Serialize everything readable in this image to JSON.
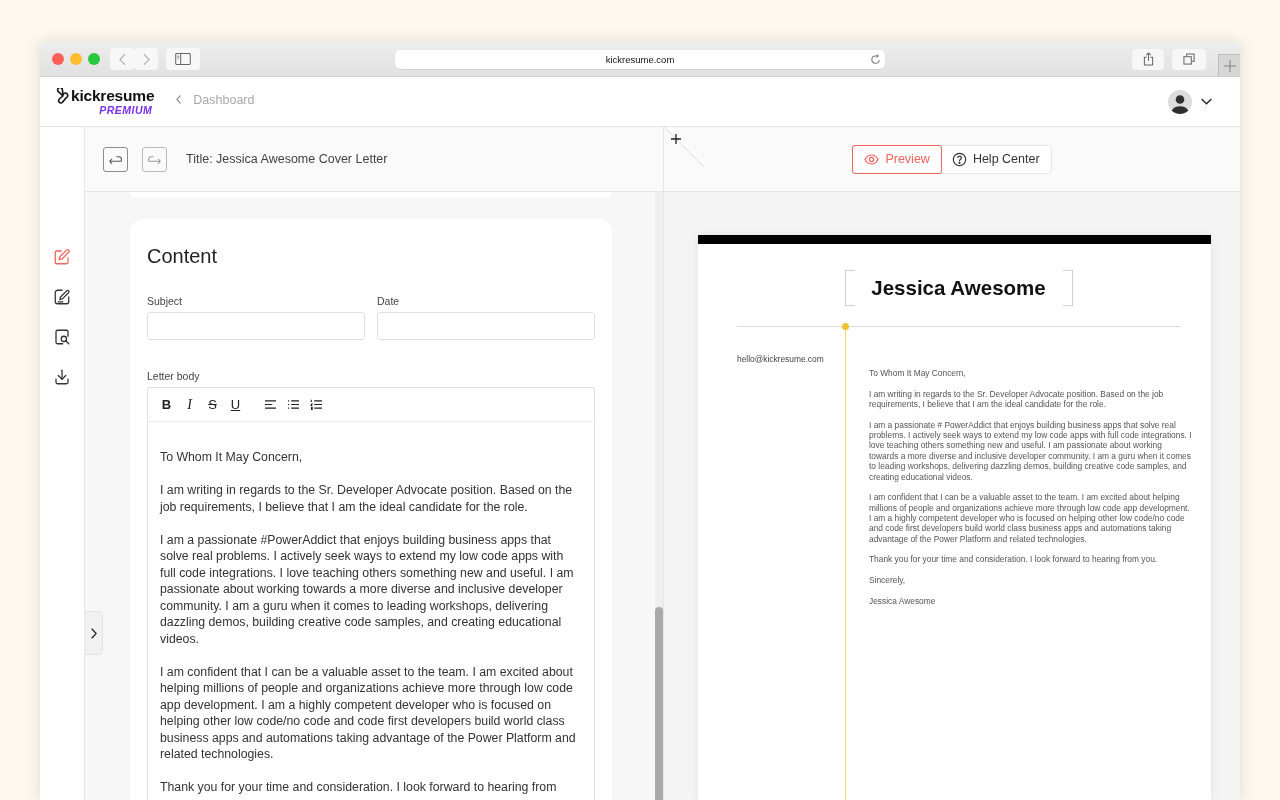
{
  "browser": {
    "url": "kickresume.com"
  },
  "header": {
    "logo_name": "kickresume",
    "logo_badge": "PREMIUM",
    "back_link": "Dashboard"
  },
  "sidebar": {
    "items": [
      {
        "kind": "edit",
        "selected": true
      },
      {
        "kind": "design",
        "selected": false
      },
      {
        "kind": "review",
        "selected": false
      },
      {
        "kind": "download",
        "selected": false
      }
    ]
  },
  "editor": {
    "history_buttons": [
      {
        "kind": "undo",
        "disabled": false
      },
      {
        "kind": "redo",
        "disabled": true
      }
    ],
    "title": "Title: Jessica Awesome Cover Letter",
    "section_title": "Content",
    "fields": [
      {
        "label": "Subject"
      },
      {
        "label": "Date"
      }
    ],
    "body_label": "Letter body",
    "format_tools": [
      {
        "kind": "bold",
        "label": "B"
      },
      {
        "kind": "italic",
        "label": "I"
      },
      {
        "kind": "strike",
        "label": "S"
      },
      {
        "kind": "underline",
        "label": "U"
      },
      {
        "kind": "align-left"
      },
      {
        "kind": "bullet-list"
      },
      {
        "kind": "numbered-list"
      }
    ],
    "body_paragraphs": [
      "To Whom It May Concern,",
      "I am writing in regards to the Sr. Developer Advocate position. Based on the job requirements, I believe that I am the ideal candidate for the role.",
      "I am a passionate #PowerAddict that enjoys building business apps that solve real problems. I actively seek ways to extend my low code apps with full code integrations. I love teaching others something new and useful. I am passionate about working towards a more diverse and inclusive developer community. I am a guru when it comes to leading workshops, delivering dazzling demos, building creative code samples, and creating educational videos.",
      "I am confident that I can be a valuable asset to the team. I am excited about helping millions of people and organizations achieve more through low code app development. I am a highly competent developer who is focused on helping other low code/no code and code first developers build world class business apps and automations taking advantage of the Power Platform and related technologies.",
      "Thank you for your time and consideration. I look forward to hearing from"
    ]
  },
  "preview": {
    "view_buttons": [
      {
        "kind": "eye",
        "label": "Preview",
        "selected": true
      },
      {
        "kind": "help",
        "label": "Help Center",
        "selected": false
      }
    ],
    "document": {
      "name": "Jessica Awesome",
      "email": "hello@kickresume.com",
      "paragraphs": [
        "To Whom It May Concern,",
        "I am writing in regards to the Sr. Developer Advocate position. Based on the job requirements, I believe that I am the ideal candidate for the role.",
        "I am a passionate # PowerAddict that enjoys building business apps that solve real problems. I actively seek ways to extend my low code apps with full code integrations. I love teaching others something new and useful. I am passionate about working towards a more diverse and inclusive developer community. I am a guru when it comes to leading workshops, delivering dazzling demos, building creative code samples, and creating educational videos.",
        "I am confident that I can be a valuable asset to the team. I am excited about helping millions of people and organizations achieve more through low code app development. I am a highly competent developer who is focused on helping other low code/no code and code first developers build world class business apps and automations taking advantage of the Power Platform and related technologies.",
        "Thank you for your time and consideration. I look forward to hearing from you.",
        "Sincerely,",
        "Jessica Awesome"
      ]
    }
  }
}
